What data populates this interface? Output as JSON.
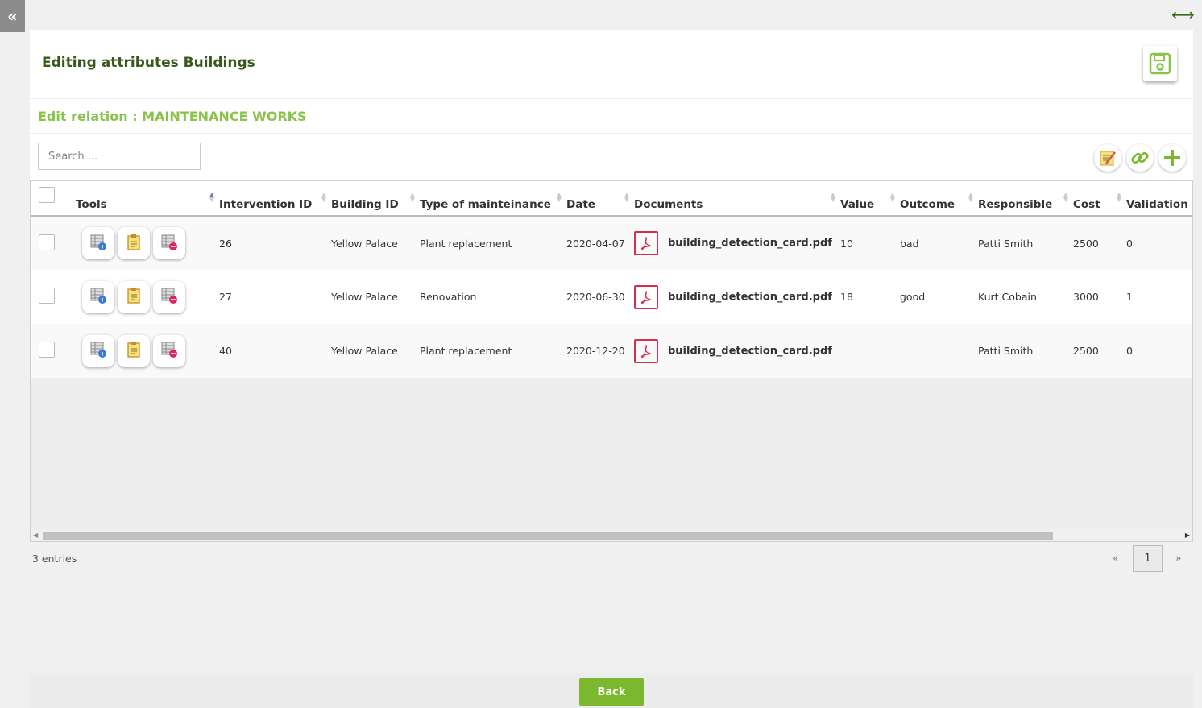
{
  "sidebar_toggle": {
    "label": "«"
  },
  "header": {
    "title": "Editing attributes Buildings",
    "expand_icon": "horizontal-arrows-icon",
    "save_icon": "floppy-disk-icon"
  },
  "relation": {
    "title": "Edit relation : MAINTENANCE WORKS"
  },
  "search": {
    "placeholder": "Search ..."
  },
  "toolbar": {
    "icons": [
      "edit-notes-icon",
      "link-icon",
      "add-icon"
    ]
  },
  "colors": {
    "accent_green": "#8bc34a",
    "title_green": "#3a5a1c",
    "pdf_red": "#d32f4f",
    "button_green": "#7cb82f"
  },
  "table": {
    "columns": [
      "Tools",
      "Intervention ID",
      "Building ID",
      "Type of mainteinance",
      "Date",
      "Documents",
      "Value",
      "Outcome",
      "Responsible",
      "Cost",
      "Validation"
    ],
    "rows": [
      {
        "id": "26",
        "building": "Yellow Palace",
        "type": "Plant replacement",
        "date": "2020-04-07",
        "doc": "building_detection_card.pdf",
        "value": "10",
        "outcome": "bad",
        "responsible": "Patti Smith",
        "cost": "2500",
        "validation": "0"
      },
      {
        "id": "27",
        "building": "Yellow Palace",
        "type": "Renovation",
        "date": "2020-06-30",
        "doc": "building_detection_card.pdf",
        "value": "18",
        "outcome": "good",
        "responsible": "Kurt Cobain",
        "cost": "3000",
        "validation": "1"
      },
      {
        "id": "40",
        "building": "Yellow Palace",
        "type": "Plant replacement",
        "date": "2020-12-20",
        "doc": "building_detection_card.pdf",
        "value": "",
        "outcome": "",
        "responsible": "Patti Smith",
        "cost": "2500",
        "validation": "0"
      }
    ]
  },
  "footer": {
    "entries": "3 entries",
    "prev": "«",
    "page": "1",
    "next": "»"
  },
  "back_button": {
    "label": "Back"
  }
}
